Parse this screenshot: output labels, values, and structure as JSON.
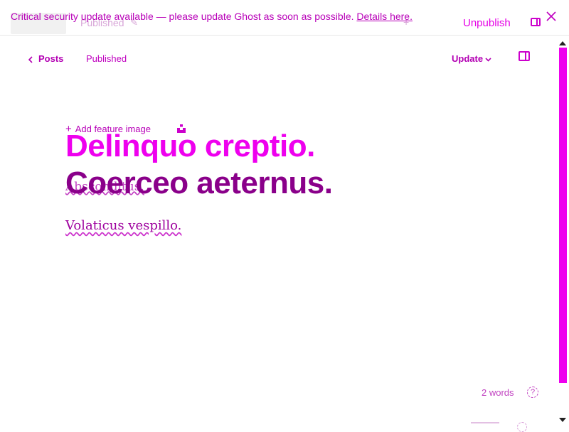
{
  "banner": {
    "message": "Critical security update available — please update Ghost as soon as possible.",
    "link": "Details here."
  },
  "ghost_header": {
    "back_label": "Posts",
    "status": "Published",
    "unpublish_label": "Unpublish"
  },
  "header": {
    "back_label": "Posts",
    "status": "Published",
    "update_label": "Update"
  },
  "editor": {
    "feature_image_label": "Add feature image",
    "title_line1": "Delinquo creptio.",
    "title_line2": "Coerceo aeternus.",
    "ghost_body": "Absconditus.",
    "body": "Volaticus vespillo."
  },
  "footer": {
    "word_count": "2 words",
    "help_icon": "?"
  },
  "icons": {
    "back": "chevron-left-icon",
    "update_dropdown": "chevron-down-icon",
    "panel": "sidebar-toggle-icon",
    "close": "close-icon",
    "unsplash": "unsplash-icon",
    "help": "help-circle-icon"
  },
  "colors": {
    "accent": "#ee00ee",
    "title_secondary": "#8a008a",
    "text": "#b300b3"
  }
}
